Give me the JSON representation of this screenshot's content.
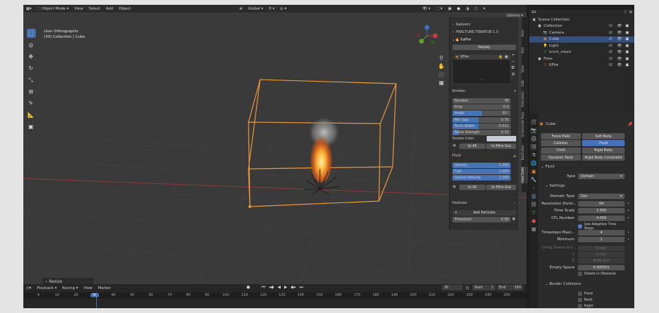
{
  "topbar": {
    "mode": "Object Mode",
    "menus": [
      "View",
      "Select",
      "Add",
      "Object"
    ],
    "orientation": "Global",
    "options": "Options"
  },
  "viewport": {
    "view_name": "User Orthographic",
    "collection_info": "(30) Collection | Cube",
    "last_op": "Resize"
  },
  "npanel": {
    "sections": [
      "Kaboom",
      "FRACTURE ITERATOR 1.5",
      "KaFire"
    ],
    "replay": "Replay",
    "list_item": "KFire",
    "list_dots": "....",
    "emitter_label": "Emitter:",
    "emitter_params": [
      {
        "label": "Number",
        "value": "38"
      },
      {
        "label": "Ring",
        "value": "0.0"
      },
      {
        "label": "Angle",
        "value": "81°"
      },
      {
        "label": "Min Size",
        "value": "0.76"
      },
      {
        "label": "Torch Width",
        "value": "0.911"
      },
      {
        "label": "Noise Strength",
        "value": "0.10"
      }
    ],
    "smoke_color": "Smoke Color",
    "to_all": "to All",
    "to_kfire_grp": "to Kfire Grp",
    "fluid_label": "Fluid",
    "fluid_params": [
      {
        "label": "Density",
        "value": "1.000"
      },
      {
        "label": "Fuel",
        "value": "1.000"
      },
      {
        "label": "Source Velocity",
        "value": "1.000"
      }
    ],
    "particles_label": "Particles",
    "add_particles": "Add Particles",
    "threshold_label": "Threshold",
    "threshold_value": "0.90",
    "tabs": [
      "Item",
      "Tool",
      "View",
      "Edit",
      "Animation",
      "Screencast Keys",
      "BoxCutter",
      "FRACTURE"
    ]
  },
  "timeline": {
    "menus": [
      "Playback",
      "Keying",
      "View",
      "Marker"
    ],
    "current_frame": "30",
    "start_label": "Start",
    "start": "1",
    "end_label": "End",
    "end": "250",
    "ruler": [
      "0",
      "10",
      "20",
      "30",
      "40",
      "50",
      "60",
      "70",
      "80",
      "90",
      "100",
      "110",
      "120",
      "130",
      "140",
      "150",
      "160",
      "170",
      "180",
      "190",
      "200",
      "210",
      "220",
      "230",
      "240",
      "250"
    ]
  },
  "outliner": {
    "rows": [
      {
        "label": "Scene Collection",
        "indent": 0,
        "selected": false,
        "vis": false
      },
      {
        "label": "Collection",
        "indent": 1,
        "selected": false,
        "vis": true
      },
      {
        "label": "Camera",
        "indent": 2,
        "selected": false,
        "vis": true
      },
      {
        "label": "Cube",
        "indent": 2,
        "selected": true,
        "vis": true
      },
      {
        "label": "Light",
        "indent": 2,
        "selected": false,
        "vis": true
      },
      {
        "label": "torch_mesh",
        "indent": 2,
        "selected": false,
        "vis": true
      },
      {
        "label": "Fires",
        "indent": 1,
        "selected": false,
        "vis": true
      },
      {
        "label": "KFire",
        "indent": 2,
        "selected": false,
        "vis": true
      }
    ]
  },
  "properties": {
    "object_name": "Cube",
    "physics_buttons": [
      [
        "Force Field",
        "Soft Body"
      ],
      [
        "Collision",
        "Fluid"
      ],
      [
        "Cloth",
        "Rigid Body"
      ],
      [
        "Dynamic Paint",
        "Rigid Body Constraint"
      ]
    ],
    "fluid_section": "Fluid",
    "type_label": "Type",
    "type_value": "Domain",
    "settings_section": "Settings",
    "settings": [
      {
        "label": "Domain Type",
        "value": "Gas"
      },
      {
        "label": "Resolution Divisi...",
        "value": "64"
      },
      {
        "label": "Time Scale",
        "value": "1.000"
      },
      {
        "label": "CFL Number",
        "value": "4.000"
      }
    ],
    "adaptive": "Use Adaptive Time Steps",
    "timesteps": [
      {
        "label": "Timesteps Maxi...",
        "value": "4"
      },
      {
        "label": "Minimum",
        "value": "1"
      }
    ],
    "scene_gravity": "Using Scene Gra...",
    "gravity": [
      {
        "label": "",
        "value": "0 m/s²"
      },
      {
        "label": "Y",
        "value": "0 m/s²"
      },
      {
        "label": "Z",
        "value": "-9.81 m/s²"
      }
    ],
    "empty_space_label": "Empty Space",
    "empty_space_value": "0.000001",
    "delete_obstacle": "Delete in Obstacle",
    "border_section": "Border Collisions",
    "borders": [
      "Front",
      "Back",
      "Right"
    ]
  },
  "colors": {
    "accent": "#4772b3",
    "selection": "#f09a3a",
    "field": "#545454",
    "panel": "#2f2f2f"
  }
}
